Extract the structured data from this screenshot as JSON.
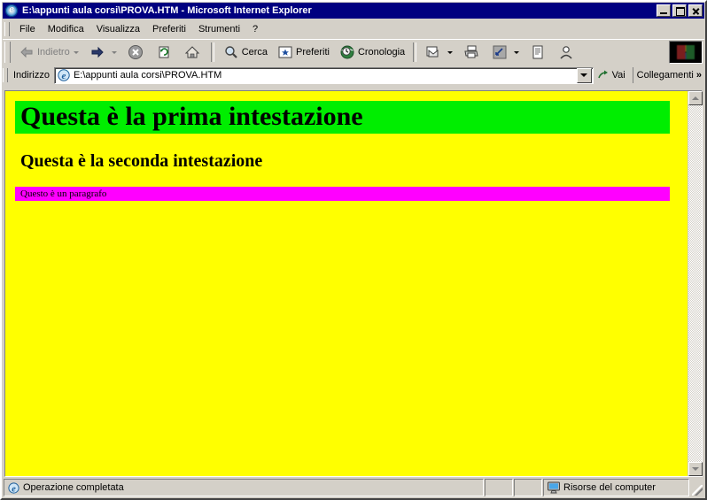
{
  "window": {
    "title": "E:\\appunti aula corsi\\PROVA.HTM - Microsoft Internet Explorer",
    "title_icon": "ie-globe-icon",
    "buttons": {
      "minimize": "minimize-button",
      "maximize": "maximize-button",
      "close": "close-button"
    }
  },
  "menubar": {
    "items": [
      {
        "label": "File",
        "accel": "F"
      },
      {
        "label": "Modifica",
        "accel": "M"
      },
      {
        "label": "Visualizza",
        "accel": "V"
      },
      {
        "label": "Preferiti",
        "accel": "P"
      },
      {
        "label": "Strumenti",
        "accel": "S"
      },
      {
        "label": "?",
        "accel": ""
      }
    ]
  },
  "toolbar": {
    "back_label": "Indietro",
    "forward_label": "",
    "stop_label": "",
    "refresh_label": "",
    "home_label": "",
    "search_label": "Cerca",
    "favorites_label": "Preferiti",
    "history_label": "Cronologia",
    "mail_label": "",
    "print_label": "",
    "edit_label": "",
    "page_label": "",
    "discuss_label": ""
  },
  "address_bar": {
    "label": "Indirizzo",
    "value": "E:\\appunti aula corsi\\PROVA.HTM",
    "placeholder": "",
    "go_label": "Vai",
    "links_label": "Collegamenti",
    "links_chevron": "»"
  },
  "page": {
    "background_color": "#FFFF00",
    "h1": {
      "text": "Questa è la prima intestazione",
      "background_color": "#00EE00",
      "text_color": "#000000"
    },
    "h2": {
      "text": "Questa è la seconda intestazione",
      "background_color": "#FFFF00",
      "text_color": "#000000"
    },
    "paragraph": {
      "text": "Questo è un paragrafo",
      "background_color": "#FF00FF",
      "text_color": "#000000"
    }
  },
  "statusbar": {
    "message": "Operazione completata",
    "zone": "Risorse del computer",
    "panel_1": "",
    "panel_2": ""
  },
  "colors": {
    "titlebar": "#000080",
    "chrome": "#D4D0C8",
    "page_bg": "#FFFF00",
    "heading_bg": "#00EE00",
    "paragraph_bg": "#FF00FF"
  }
}
